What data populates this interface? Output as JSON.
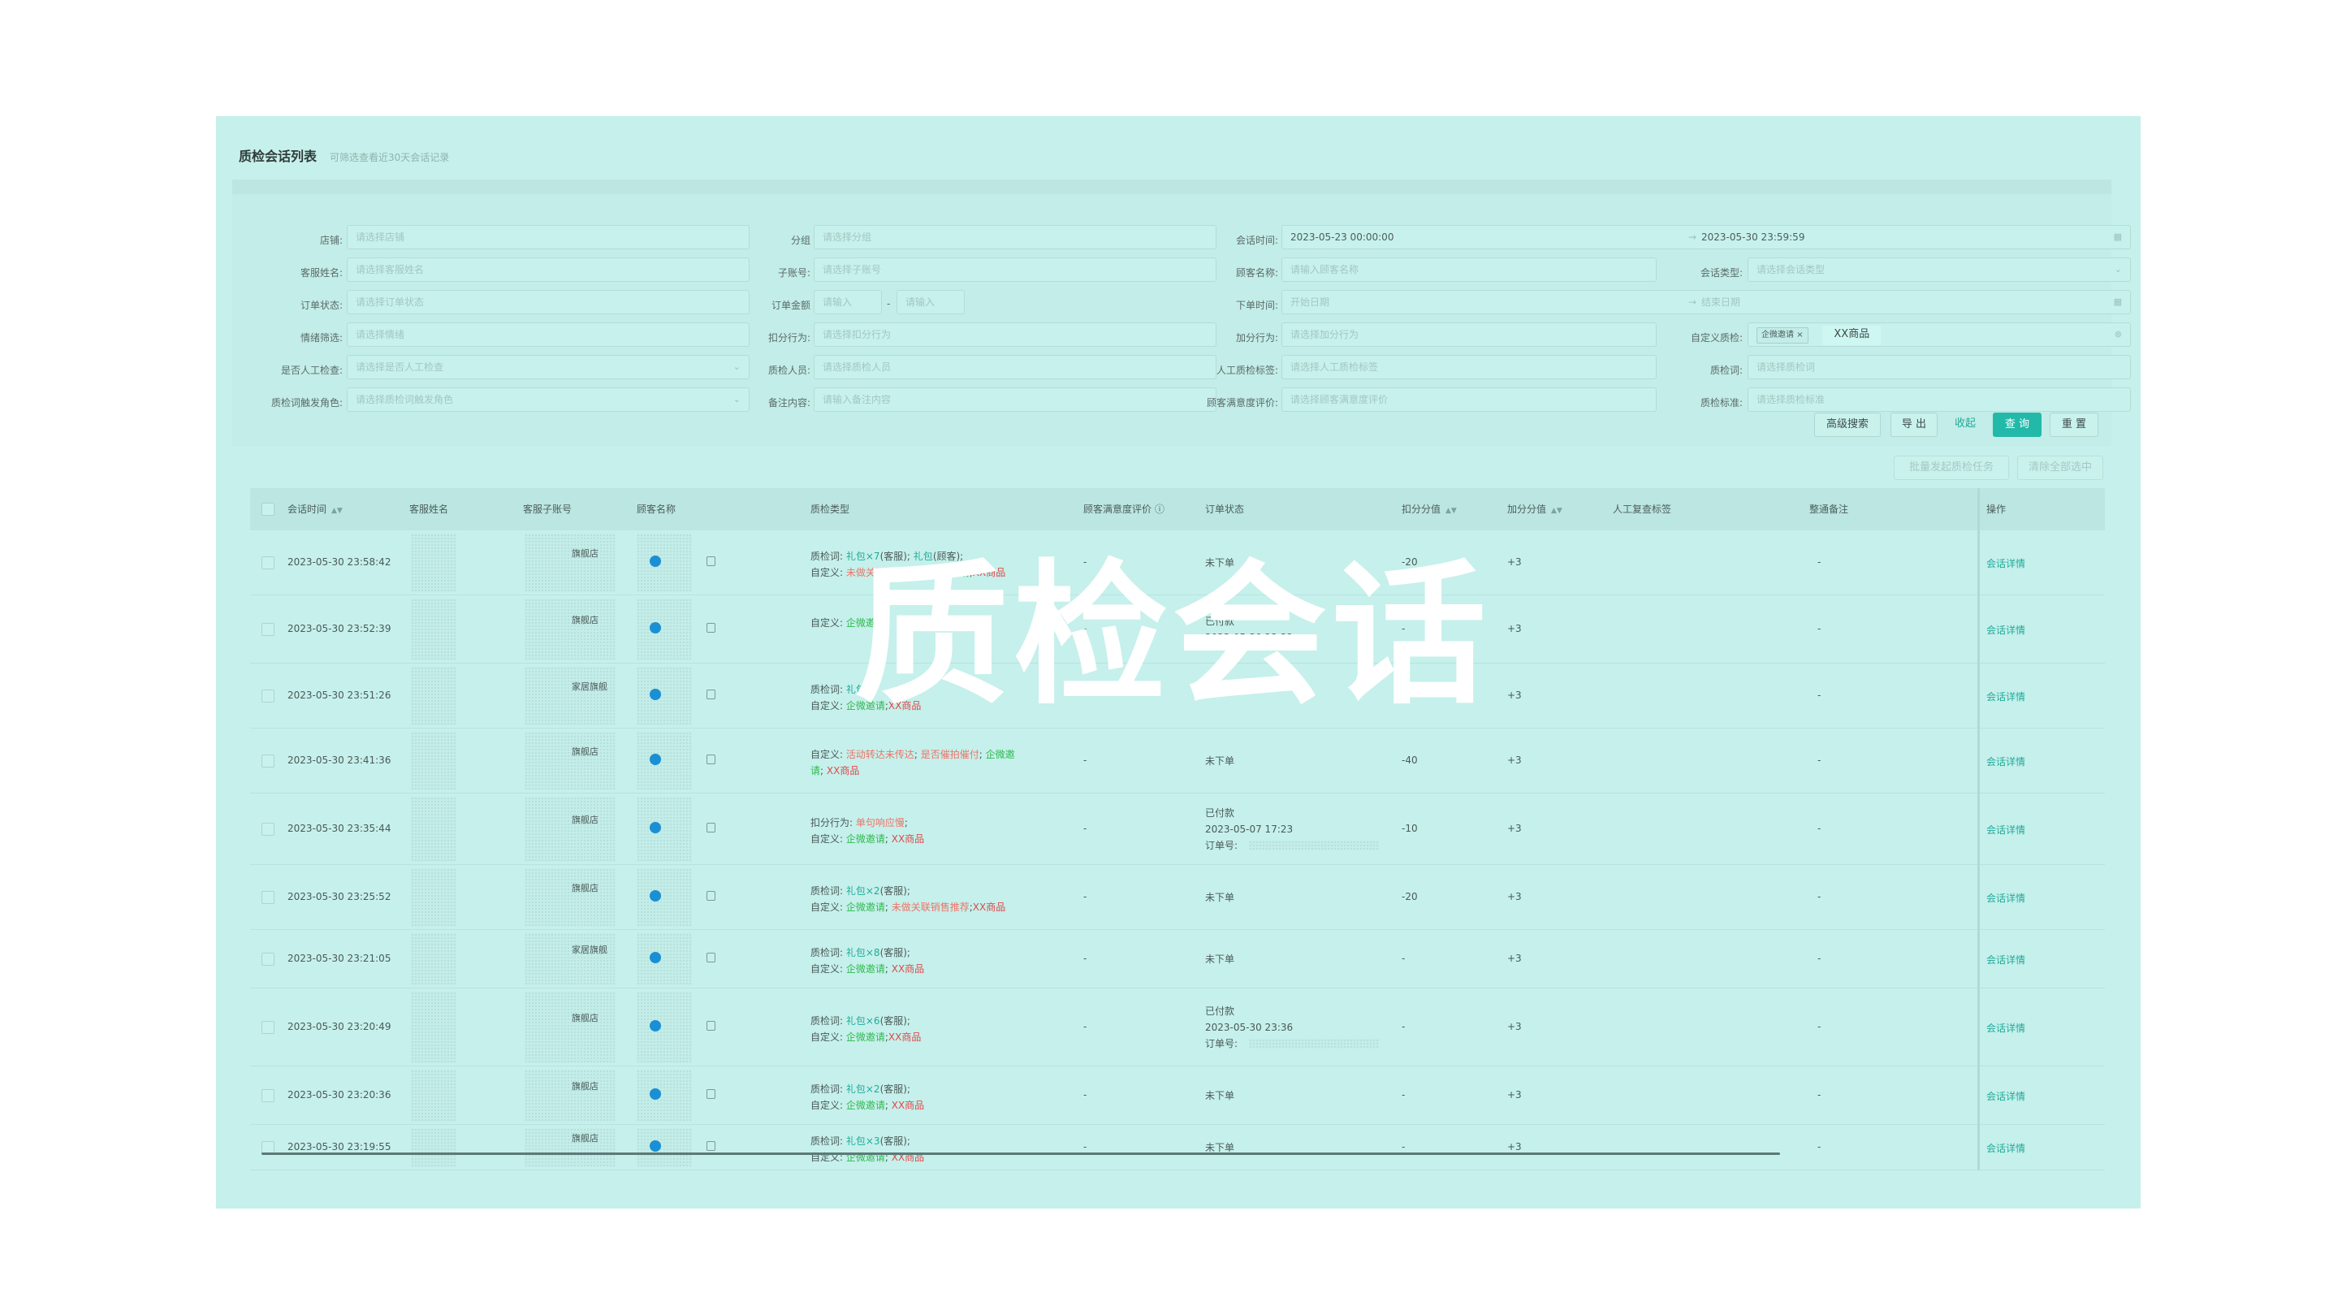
{
  "header": {
    "title": "质检会话列表",
    "subtitle": "可筛选查看近30天会话记录"
  },
  "filters": {
    "shop": {
      "label": "店铺:",
      "placeholder": "请选择店铺"
    },
    "group": {
      "label": "分组",
      "placeholder": "请选择分组"
    },
    "session_time": {
      "label": "会话时间:",
      "start": "2023-05-23 00:00:00",
      "sep": "→",
      "end": "2023-05-30 23:59:59"
    },
    "agent_name": {
      "label": "客服姓名:",
      "placeholder": "请选择客服姓名"
    },
    "sub_account": {
      "label": "子账号:",
      "placeholder": "请选择子账号"
    },
    "customer_name": {
      "label": "顾客名称:",
      "placeholder": "请输入顾客名称"
    },
    "session_type": {
      "label": "会话类型:",
      "placeholder": "请选择会话类型"
    },
    "order_status": {
      "label": "订单状态:",
      "placeholder": "请选择订单状态"
    },
    "order_amount": {
      "label": "订单金额",
      "min_placeholder": "请输入",
      "sep": "-",
      "max_placeholder": "请输入"
    },
    "order_time": {
      "label": "下单时间:",
      "start_placeholder": "开始日期",
      "sep": "→",
      "end_placeholder": "结束日期"
    },
    "emotion": {
      "label": "情绪筛选:",
      "placeholder": "请选择情绪"
    },
    "deduct_action": {
      "label": "扣分行为:",
      "placeholder": "请选择扣分行为"
    },
    "bonus_action": {
      "label": "加分行为:",
      "placeholder": "请选择加分行为"
    },
    "custom_qc": {
      "label": "自定义质检:",
      "tag": "企微邀请",
      "tag_close": "×",
      "value": "XX商品"
    },
    "manual_check": {
      "label": "是否人工检查:",
      "placeholder": "请选择是否人工检查"
    },
    "qc_person": {
      "label": "质检人员:",
      "placeholder": "请选择质检人员"
    },
    "manual_tag": {
      "label": "人工质检标签:",
      "placeholder": "请选择人工质检标签"
    },
    "qc_word": {
      "label": "质检词:",
      "placeholder": "请选择质检词"
    },
    "trigger_role": {
      "label": "质检词触发角色:",
      "placeholder": "请选择质检词触发角色"
    },
    "remark": {
      "label": "备注内容:",
      "placeholder": "请输入备注内容"
    },
    "satisfaction": {
      "label": "顾客满意度评价:",
      "placeholder": "请选择顾客满意度评价"
    },
    "qc_standard": {
      "label": "质检标准:",
      "placeholder": "请选择质检标准"
    }
  },
  "buttons": {
    "advanced": "高级搜索",
    "export": "导 出",
    "collapse": "收起",
    "query": "查 询",
    "reset": "重 置",
    "batch_task": "批量发起质检任务",
    "clear_selection": "清除全部选中"
  },
  "table": {
    "headers": {
      "session_time": "会话时间",
      "agent_name": "客服姓名",
      "sub_account": "客服子账号",
      "customer": "顾客名称",
      "qc_type": "质检类型",
      "satisfaction": "顾客满意度评价",
      "order_status": "订单状态",
      "deduct": "扣分分值",
      "bonus": "加分分值",
      "manual_tag": "人工复查标签",
      "remark": "整通备注",
      "action": "操作"
    },
    "rows": [
      {
        "time": "2023-05-30 23:58:42",
        "shop": "旗舰店",
        "qc_lines": [
          [
            {
              "t": "质检词: ",
              "c": ""
            },
            {
              "t": "礼包×7",
              "c": "teal"
            },
            {
              "t": "(客服); ",
              "c": ""
            },
            {
              "t": "礼包",
              "c": "teal"
            },
            {
              "t": "(顾客);",
              "c": ""
            }
          ],
          [
            {
              "t": "自定义: ",
              "c": ""
            },
            {
              "t": "未做关联销售推荐",
              "c": "salmon"
            },
            {
              "t": "; ",
              "c": ""
            },
            {
              "t": "企微邀请",
              "c": "green"
            },
            {
              "t": ";",
              "c": ""
            },
            {
              "t": "XX商品",
              "c": "red"
            }
          ]
        ],
        "satisfaction": "-",
        "order": [
          "未下单"
        ],
        "deduct": "-20",
        "bonus": "+3",
        "remark": "-",
        "action": "会话详情"
      },
      {
        "time": "2023-05-30 23:52:39",
        "shop": "旗舰店",
        "qc_lines": [
          [
            {
              "t": "自定义: ",
              "c": ""
            },
            {
              "t": "企微邀请",
              "c": "green"
            }
          ]
        ],
        "satisfaction": "-",
        "order": [
          "已付款",
          "2023-05-30 23:32"
        ],
        "deduct": "-",
        "bonus": "+3",
        "remark": "-",
        "action": "会话详情"
      },
      {
        "time": "2023-05-30 23:51:26",
        "shop": "家居旗舰",
        "qc_lines": [
          [
            {
              "t": "质检词: ",
              "c": ""
            },
            {
              "t": "礼包",
              "c": "teal"
            }
          ],
          [
            {
              "t": "自定义: ",
              "c": ""
            },
            {
              "t": "企微邀请",
              "c": "green"
            },
            {
              "t": ";",
              "c": ""
            },
            {
              "t": "XX商品",
              "c": "red"
            }
          ]
        ],
        "satisfaction": "-",
        "order": [
          "-"
        ],
        "deduct": "-",
        "bonus": "+3",
        "remark": "-",
        "action": "会话详情"
      },
      {
        "time": "2023-05-30 23:41:36",
        "shop": "旗舰店",
        "qc_lines": [
          [
            {
              "t": "自定义: ",
              "c": ""
            },
            {
              "t": "活动转达未传达",
              "c": "salmon"
            },
            {
              "t": "; ",
              "c": ""
            },
            {
              "t": "是否催拍催付",
              "c": "salmon"
            },
            {
              "t": "; ",
              "c": ""
            },
            {
              "t": "企微邀",
              "c": "green"
            }
          ],
          [
            {
              "t": "请",
              "c": "green"
            },
            {
              "t": ";  ",
              "c": ""
            },
            {
              "t": "XX商品",
              "c": "red"
            }
          ]
        ],
        "satisfaction": "-",
        "order": [
          "未下单"
        ],
        "deduct": "-40",
        "bonus": "+3",
        "remark": "-",
        "action": "会话详情"
      },
      {
        "time": "2023-05-30 23:35:44",
        "shop": "旗舰店",
        "qc_lines": [
          [
            {
              "t": "扣分行为: ",
              "c": ""
            },
            {
              "t": "单句响应慢",
              "c": "salmon"
            },
            {
              "t": ";",
              "c": ""
            }
          ],
          [
            {
              "t": "自定义: ",
              "c": ""
            },
            {
              "t": "企微邀请",
              "c": "green"
            },
            {
              "t": ";  ",
              "c": ""
            },
            {
              "t": "XX商品",
              "c": "red"
            }
          ]
        ],
        "satisfaction": "-",
        "order": [
          "已付款",
          "2023-05-07 17:23",
          "订单号:"
        ],
        "deduct": "-10",
        "bonus": "+3",
        "remark": "-",
        "action": "会话详情"
      },
      {
        "time": "2023-05-30 23:25:52",
        "shop": "旗舰店",
        "qc_lines": [
          [
            {
              "t": "质检词: ",
              "c": ""
            },
            {
              "t": "礼包×2",
              "c": "teal"
            },
            {
              "t": "(客服);",
              "c": ""
            }
          ],
          [
            {
              "t": "自定义: ",
              "c": ""
            },
            {
              "t": "企微邀请",
              "c": "green"
            },
            {
              "t": "; ",
              "c": ""
            },
            {
              "t": "未做关联销售推荐",
              "c": "salmon"
            },
            {
              "t": ";",
              "c": ""
            },
            {
              "t": "XX商品",
              "c": "red"
            }
          ]
        ],
        "satisfaction": "-",
        "order": [
          "未下单"
        ],
        "deduct": "-20",
        "bonus": "+3",
        "remark": "-",
        "action": "会话详情"
      },
      {
        "time": "2023-05-30 23:21:05",
        "shop": "家居旗舰",
        "qc_lines": [
          [
            {
              "t": "质检词: ",
              "c": ""
            },
            {
              "t": "礼包×8",
              "c": "teal"
            },
            {
              "t": "(客服);",
              "c": ""
            }
          ],
          [
            {
              "t": "自定义: ",
              "c": ""
            },
            {
              "t": "企微邀请",
              "c": "green"
            },
            {
              "t": ";  ",
              "c": ""
            },
            {
              "t": "XX商品",
              "c": "red"
            }
          ]
        ],
        "satisfaction": "-",
        "order": [
          "未下单"
        ],
        "deduct": "-",
        "bonus": "+3",
        "remark": "-",
        "action": "会话详情"
      },
      {
        "time": "2023-05-30 23:20:49",
        "shop": "旗舰店",
        "qc_lines": [
          [
            {
              "t": "质检词: ",
              "c": ""
            },
            {
              "t": "礼包×6",
              "c": "teal"
            },
            {
              "t": "(客服);",
              "c": ""
            }
          ],
          [
            {
              "t": "自定义: ",
              "c": ""
            },
            {
              "t": "企微邀请",
              "c": "green"
            },
            {
              "t": ";",
              "c": ""
            },
            {
              "t": "XX商品",
              "c": "red"
            }
          ]
        ],
        "satisfaction": "-",
        "order": [
          "已付款",
          "2023-05-30 23:36",
          "订单号:"
        ],
        "deduct": "-",
        "bonus": "+3",
        "remark": "-",
        "action": "会话详情"
      },
      {
        "time": "2023-05-30 23:20:36",
        "shop": "旗舰店",
        "qc_lines": [
          [
            {
              "t": "质检词: ",
              "c": ""
            },
            {
              "t": "礼包×2",
              "c": "teal"
            },
            {
              "t": "(客服);",
              "c": ""
            }
          ],
          [
            {
              "t": "自定义: ",
              "c": ""
            },
            {
              "t": "企微邀请",
              "c": "green"
            },
            {
              "t": ";  ",
              "c": ""
            },
            {
              "t": "XX商品",
              "c": "red"
            }
          ]
        ],
        "satisfaction": "-",
        "order": [
          "未下单"
        ],
        "deduct": "-",
        "bonus": "+3",
        "remark": "-",
        "action": "会话详情"
      },
      {
        "time": "2023-05-30 23:19:55",
        "shop": "旗舰店",
        "qc_lines": [
          [
            {
              "t": "质检词: ",
              "c": ""
            },
            {
              "t": "礼包×3",
              "c": "teal"
            },
            {
              "t": "(客服);",
              "c": ""
            }
          ],
          [
            {
              "t": "自定义: ",
              "c": ""
            },
            {
              "t": "企微邀请",
              "c": "green"
            },
            {
              "t": ";  ",
              "c": ""
            },
            {
              "t": "XX商品",
              "c": "red"
            }
          ]
        ],
        "satisfaction": "-",
        "order": [
          "未下单"
        ],
        "deduct": "-",
        "bonus": "+3",
        "remark": "-",
        "action": "会话详情"
      }
    ]
  },
  "watermark": "质检会话",
  "colors": {
    "background": "#c6f0eb",
    "accent": "#23b9a9",
    "link": "#20aa9b",
    "warning": "#e0484a",
    "positive": "#2fb94f"
  }
}
